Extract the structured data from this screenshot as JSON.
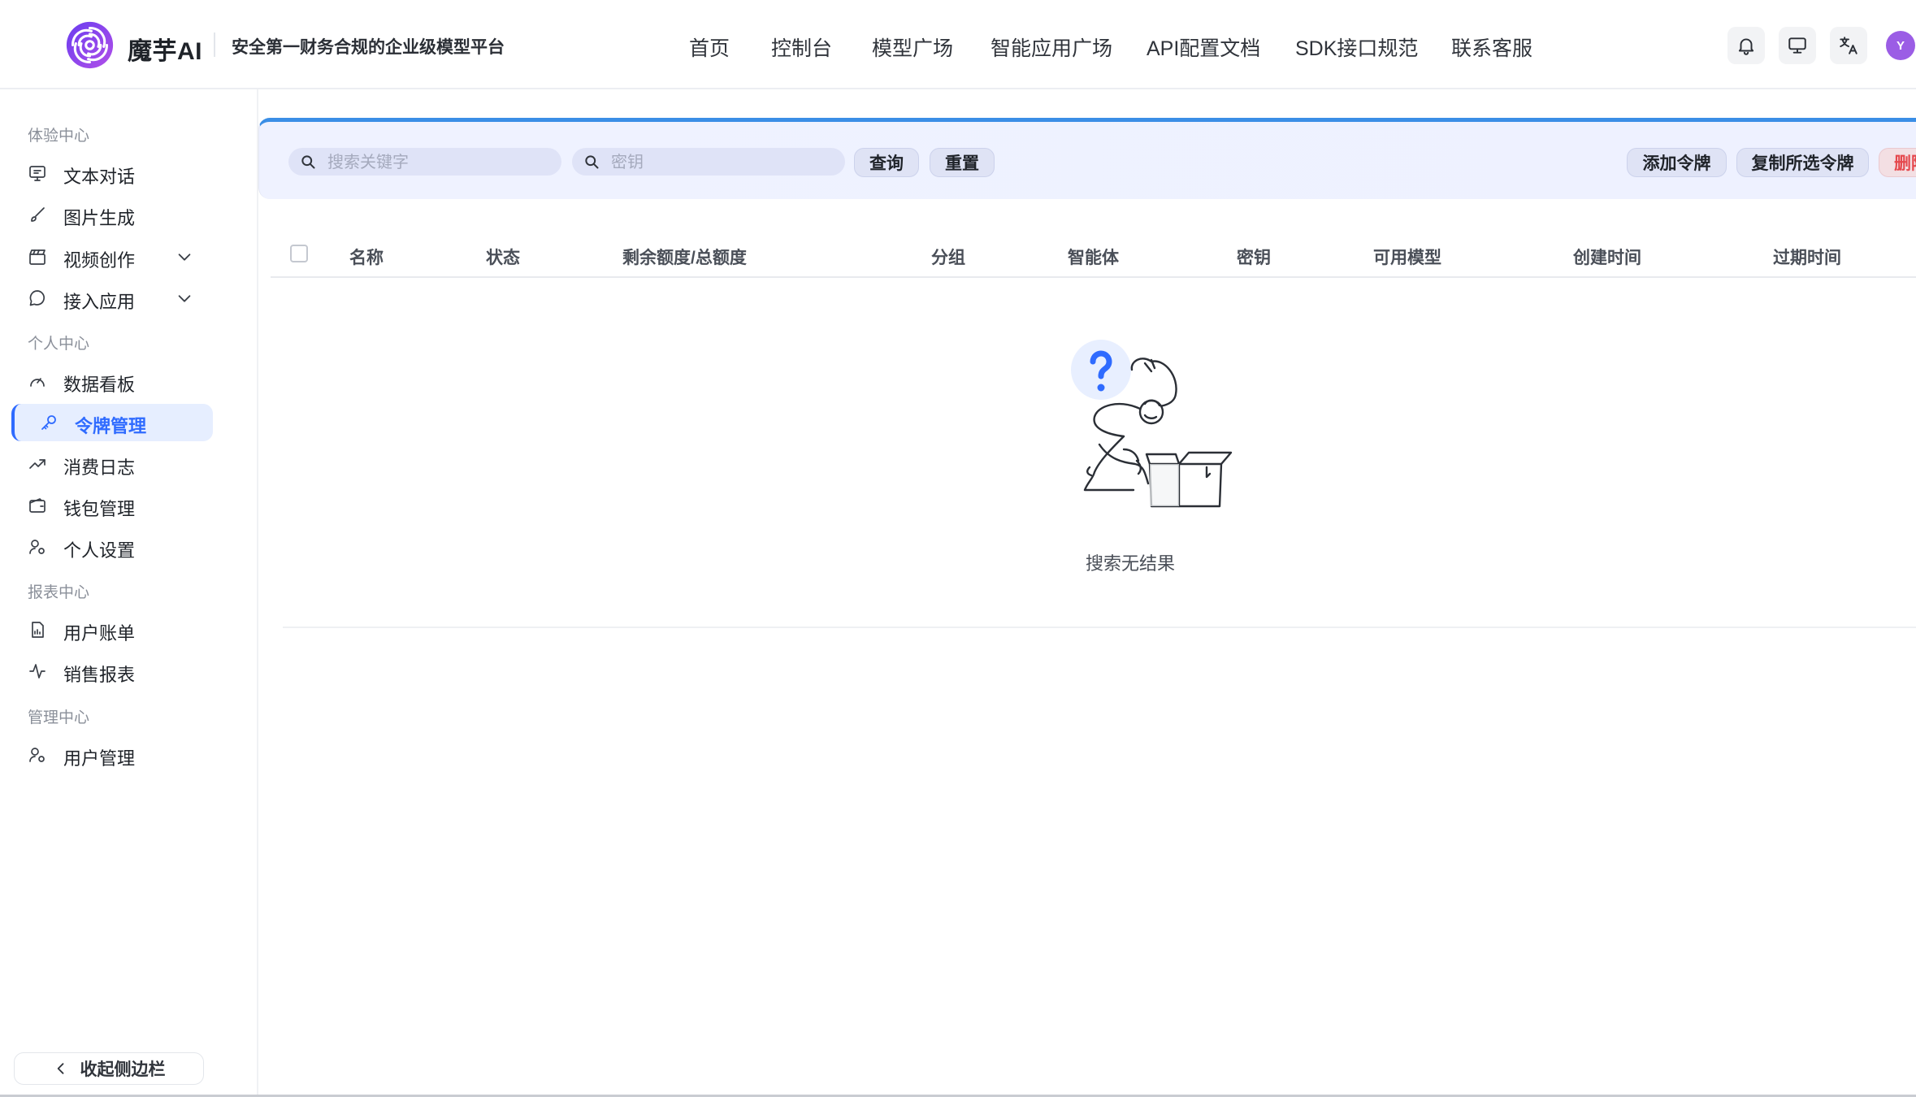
{
  "app": {
    "brand_name": "魔芋AI",
    "slogan": "安全第一财务合规的企业级模型平台",
    "avatar_letter": "Y"
  },
  "nav": {
    "items": [
      {
        "label": "首页"
      },
      {
        "label": "控制台"
      },
      {
        "label": "模型广场"
      },
      {
        "label": "智能应用广场"
      },
      {
        "label": "API配置文档"
      },
      {
        "label": "SDK接口规范"
      },
      {
        "label": "联系客服"
      }
    ]
  },
  "header_icons": [
    "bell-icon",
    "monitor-icon",
    "translate-icon"
  ],
  "sidebar": {
    "sections": [
      {
        "title": "体验中心",
        "items": [
          {
            "label": "文本对话",
            "icon": "chat-screen-icon"
          },
          {
            "label": "图片生成",
            "icon": "brush-icon"
          },
          {
            "label": "视频创作",
            "icon": "clapperboard-icon",
            "expandable": true
          },
          {
            "label": "接入应用",
            "icon": "message-bubble-icon",
            "expandable": true
          }
        ]
      },
      {
        "title": "个人中心",
        "items": [
          {
            "label": "数据看板",
            "icon": "gauge-icon"
          },
          {
            "label": "令牌管理",
            "icon": "key-icon",
            "active": true
          },
          {
            "label": "消费日志",
            "icon": "trend-up-icon"
          },
          {
            "label": "钱包管理",
            "icon": "wallet-icon"
          },
          {
            "label": "个人设置",
            "icon": "user-settings-icon"
          }
        ]
      },
      {
        "title": "报表中心",
        "items": [
          {
            "label": "用户账单",
            "icon": "bill-icon"
          },
          {
            "label": "销售报表",
            "icon": "activity-icon"
          }
        ]
      },
      {
        "title": "管理中心",
        "items": [
          {
            "label": "用户管理",
            "icon": "user-manage-icon"
          }
        ]
      }
    ],
    "collapse_label": "收起侧边栏"
  },
  "toolbar": {
    "keyword_placeholder": "搜索关键字",
    "key_placeholder": "密钥",
    "query_label": "查询",
    "reset_label": "重置",
    "add_label": "添加令牌",
    "copy_label": "复制所选令牌",
    "delete_label": "删除所选令牌"
  },
  "table": {
    "columns": [
      "名称",
      "状态",
      "剩余额度/总额度",
      "分组",
      "智能体",
      "密钥",
      "可用模型",
      "创建时间",
      "过期时间"
    ],
    "rows": [],
    "empty_text": "搜索无结果"
  },
  "colors": {
    "accent": "#2f6bff",
    "toolbar_bar": "#3a8ee6",
    "danger": "#e5484d",
    "avatar": "#9b5de5"
  }
}
